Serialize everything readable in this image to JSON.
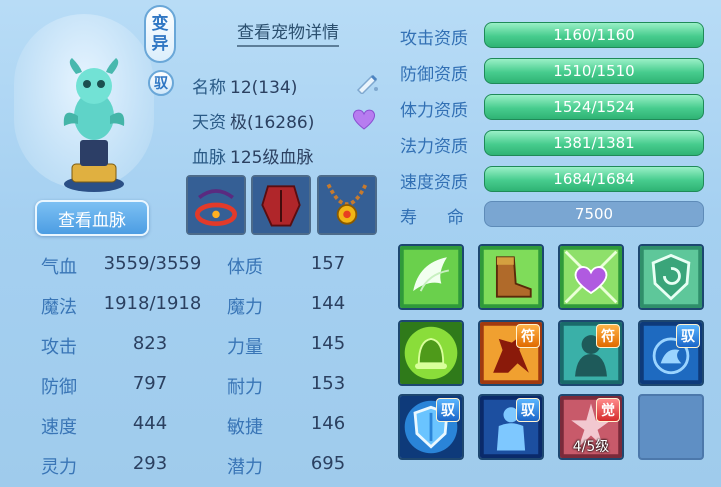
{
  "pet": {
    "variant_tag": "变异",
    "variant_tag_chars": [
      "变",
      "异"
    ],
    "tame_tag": "驭",
    "detail_link": "查看宠物详情",
    "blood_button": "查看血脉",
    "name_label": "名称",
    "name_value": "12(134)",
    "talent_label": "天资",
    "talent_value": "极(16286)",
    "bloodline_label": "血脉",
    "bloodline_value": "125级血脉"
  },
  "equipment": [
    {
      "name": "collar"
    },
    {
      "name": "armor"
    },
    {
      "name": "necklace"
    }
  ],
  "stats": [
    {
      "label": "气血",
      "value": "3559/3559",
      "label2": "体质",
      "value2": "157"
    },
    {
      "label": "魔法",
      "value": "1918/1918",
      "label2": "魔力",
      "value2": "144"
    },
    {
      "label": "攻击",
      "value": "823",
      "label2": "力量",
      "value2": "145"
    },
    {
      "label": "防御",
      "value": "797",
      "label2": "耐力",
      "value2": "153"
    },
    {
      "label": "速度",
      "value": "444",
      "label2": "敏捷",
      "value2": "146"
    },
    {
      "label": "灵力",
      "value": "293",
      "label2": "潜力",
      "value2": "695"
    }
  ],
  "aptitudes": [
    {
      "label": "攻击资质",
      "value": "1160/1160"
    },
    {
      "label": "防御资质",
      "value": "1510/1510"
    },
    {
      "label": "体力资质",
      "value": "1524/1524"
    },
    {
      "label": "法力资质",
      "value": "1381/1381"
    },
    {
      "label": "速度资质",
      "value": "1684/1684"
    }
  ],
  "life": {
    "label": "寿命",
    "label_chars": [
      "寿",
      "命"
    ],
    "value": "7500"
  },
  "skills": [
    {
      "icon": "wings-icon",
      "badge": ""
    },
    {
      "icon": "boot-icon",
      "badge": ""
    },
    {
      "icon": "heart-icon",
      "badge": ""
    },
    {
      "icon": "shield-heal-icon",
      "badge": ""
    },
    {
      "icon": "bell-icon",
      "badge": ""
    },
    {
      "icon": "horse-icon",
      "badge": "符"
    },
    {
      "icon": "ghost-icon",
      "badge": "符"
    },
    {
      "icon": "beast-icon",
      "badge": "驭"
    },
    {
      "icon": "shield-icon",
      "badge": "驭"
    },
    {
      "icon": "guardian-icon",
      "badge": "驭"
    },
    {
      "icon": "awaken-icon",
      "badge": "觉",
      "level": "4/5级"
    }
  ]
}
